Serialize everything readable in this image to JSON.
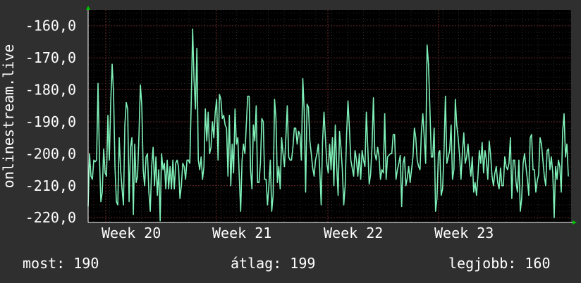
{
  "chart_data": {
    "type": "line",
    "ylabel": "onlinestream.live",
    "ylim": [
      -220,
      -155
    ],
    "yticks": [
      -160,
      -170,
      -180,
      -190,
      -200,
      -210,
      -220
    ],
    "ytick_labels": [
      "-160,0",
      "-170,0",
      "-180,0",
      "-190,0",
      "-200,0",
      "-210,0",
      "-220,0"
    ],
    "week_labels": [
      "Week 20",
      "Week 21",
      "Week 22",
      "Week 23"
    ],
    "grid": true,
    "series_color": "#7ff0b8",
    "x": [
      0,
      2,
      4,
      6,
      8,
      10,
      12,
      14,
      16,
      18,
      20,
      22,
      24,
      26,
      28,
      30,
      32,
      34,
      36,
      38,
      40,
      42,
      44,
      46,
      48,
      50,
      52,
      54,
      56,
      58,
      60,
      62,
      64,
      66,
      68,
      70,
      72,
      74,
      76,
      78,
      80,
      82,
      84,
      86,
      88,
      90,
      92,
      94,
      96,
      98,
      100,
      102,
      104,
      106,
      108,
      110,
      112,
      114,
      116,
      118,
      120,
      122,
      124,
      126,
      128,
      130,
      132,
      134,
      136,
      138,
      140,
      142,
      144,
      146,
      148,
      150,
      152,
      154,
      156,
      158,
      160,
      162,
      164,
      166,
      168,
      170,
      172,
      174,
      176,
      178,
      180,
      182,
      184,
      186,
      188,
      190,
      192,
      194,
      196,
      198,
      200,
      202,
      204,
      206,
      208,
      210,
      212,
      214,
      216,
      218,
      220,
      222,
      224,
      226,
      228,
      230,
      232,
      234,
      236,
      238,
      240,
      242,
      244,
      246,
      248,
      250,
      252,
      254,
      256,
      258,
      260,
      262,
      264,
      266,
      268,
      270,
      272,
      274,
      276,
      278,
      280,
      282,
      284,
      286,
      288,
      290,
      292,
      294,
      296,
      298,
      300,
      302,
      304,
      306,
      308,
      310,
      312,
      314,
      316,
      318,
      320,
      322,
      324,
      326,
      328,
      330,
      332,
      334,
      336,
      338,
      340,
      342,
      344,
      346,
      348,
      350,
      352,
      354,
      356,
      358,
      360,
      362,
      364,
      366,
      368,
      370,
      372,
      374,
      376,
      378,
      380,
      382,
      384,
      386,
      388,
      390,
      392,
      394,
      396,
      398,
      400,
      402,
      404,
      406,
      408,
      410,
      412,
      414,
      416,
      418,
      420,
      422,
      424,
      426,
      428,
      430,
      432,
      434,
      436,
      438,
      440,
      442,
      444,
      446,
      448,
      450,
      452,
      454,
      456,
      458,
      460,
      462,
      464,
      466,
      468,
      470,
      472,
      474,
      476,
      478,
      480,
      482,
      484,
      486,
      488,
      490,
      492,
      494,
      496,
      498,
      500,
      502,
      504,
      506,
      508,
      510,
      512,
      514,
      516,
      518,
      520,
      522,
      524,
      526,
      528,
      530,
      532,
      534,
      536,
      538,
      540,
      542,
      544,
      546,
      548,
      550,
      552,
      554,
      556,
      558,
      560,
      562,
      564,
      566,
      568,
      570,
      572,
      574,
      576,
      578,
      580,
      582,
      584,
      586,
      588,
      590,
      592,
      594,
      596,
      598,
      600,
      602,
      604,
      606,
      608,
      610,
      612,
      614,
      616,
      618,
      620,
      622,
      624,
      626,
      628,
      630,
      632,
      634,
      636,
      638,
      640,
      642,
      644,
      646,
      648,
      650,
      652,
      654,
      656,
      658,
      660,
      662,
      664,
      666,
      668,
      670,
      672,
      674,
      676,
      678,
      680
    ],
    "y": [
      -216.5,
      -200.0,
      -207.0,
      -208.0,
      -202.0,
      -202.5,
      -202.0,
      -178.0,
      -201.0,
      -215.0,
      -212.0,
      -198.5,
      -206.0,
      -207.0,
      -188.0,
      -202.0,
      -184.0,
      -172.0,
      -181.0,
      -204.0,
      -215.0,
      -216.0,
      -195.0,
      -205.0,
      -211.0,
      -216.0,
      -191.0,
      -184.0,
      -186.0,
      -215.0,
      -198.0,
      -195.0,
      -219.0,
      -197.0,
      -209.0,
      -207.0,
      -194.0,
      -178.5,
      -185.0,
      -205.0,
      -210.0,
      -201.0,
      -200.0,
      -212.0,
      -218.0,
      -204.0,
      -198.0,
      -210.0,
      -201.0,
      -213.0,
      -205.0,
      -221.0,
      -200.0,
      -205.0,
      -203.0,
      -211.0,
      -202.0,
      -211.0,
      -204.0,
      -211.0,
      -202.0,
      -211.0,
      -203.0,
      -202.0,
      -204.0,
      -214.0,
      -210.0,
      -203.0,
      -204.0,
      -208.0,
      -202.0,
      -202.0,
      -203.0,
      -184.0,
      -161.0,
      -177.0,
      -186.0,
      -167.0,
      -202.0,
      -205.0,
      -201.0,
      -208.0,
      -204.0,
      -186.0,
      -196.0,
      -187.0,
      -200.0,
      -198.0,
      -190.0,
      -195.0,
      -187.0,
      -183.0,
      -202.0,
      -181.5,
      -183.0,
      -189.0,
      -188.0,
      -191.0,
      -192.0,
      -207.0,
      -188.0,
      -210.0,
      -197.0,
      -206.0,
      -186.0,
      -197.0,
      -195.0,
      -207.0,
      -218.0,
      -202.0,
      -197.0,
      -200.0,
      -191.0,
      -182.0,
      -182.0,
      -205.0,
      -211.0,
      -191.0,
      -196.0,
      -185.0,
      -209.0,
      -209.0,
      -203.0,
      -189.0,
      -190.0,
      -208.0,
      -208.0,
      -216.0,
      -210.0,
      -202.0,
      -218.0,
      -213.0,
      -183.0,
      -189.0,
      -209.0,
      -204.0,
      -211.0,
      -195.0,
      -200.0,
      -204.0,
      -195.0,
      -185.0,
      -201.0,
      -202.0,
      -202.0,
      -198.0,
      -192.0,
      -192.0,
      -197.0,
      -193.0,
      -194.0,
      -202.0,
      -176.5,
      -186.5,
      -212.0,
      -184.5,
      -185.5,
      -196.0,
      -200.0,
      -204.5,
      -207.0,
      -202.0,
      -200.0,
      -197.0,
      -205.0,
      -216.0,
      -196.0,
      -187.0,
      -195.0,
      -203.0,
      -206.0,
      -197.0,
      -205.0,
      -195.0,
      -210.0,
      -191.0,
      -204.0,
      -213.0,
      -193.0,
      -198.0,
      -205.0,
      -216.0,
      -210.0,
      -194.0,
      -183.5,
      -192.0,
      -202.0,
      -204.5,
      -207.0,
      -199.0,
      -202.0,
      -207.0,
      -200.0,
      -208.0,
      -199.0,
      -202.0,
      -204.0,
      -187.0,
      -198.0,
      -209.5,
      -206.5,
      -198.0,
      -182.5,
      -200.0,
      -202.0,
      -198.0,
      -201.0,
      -208.0,
      -205.0,
      -206.0,
      -187.5,
      -208.0,
      -201.0,
      -200.5,
      -200.0,
      -200.0,
      -194.0,
      -194.0,
      -208.0,
      -205.0,
      -203.0,
      -200.5,
      -216.5,
      -203.0,
      -201.0,
      -210.0,
      -207.5,
      -204.0,
      -209.0,
      -205.0,
      -201.0,
      -192.0,
      -195.0,
      -202.0,
      -204.0,
      -205.0,
      -193.0,
      -187.5,
      -195.0,
      -203.0,
      -166.0,
      -172.0,
      -186.0,
      -201.0,
      -201.0,
      -192.0,
      -218.0,
      -214.0,
      -200.0,
      -199.0,
      -213.0,
      -211.0,
      -199.0,
      -182.0,
      -203.0,
      -201.0,
      -199.0,
      -191.0,
      -208.0,
      -205.0,
      -183.0,
      -191.0,
      -195.0,
      -200.5,
      -208.0,
      -199.5,
      -193.5,
      -203.0,
      -201.0,
      -197.0,
      -203.0,
      -207.0,
      -201.0,
      -212.0,
      -209.0,
      -213.0,
      -207.0,
      -199.0,
      -203.0,
      -196.5,
      -206.0,
      -199.0,
      -202.0,
      -208.0,
      -196.0,
      -200.5,
      -207.0,
      -210.0,
      -206.0,
      -204.0,
      -209.0,
      -211.0,
      -204.5,
      -210.0,
      -210.0,
      -201.0,
      -204.0,
      -205.0,
      -203.0,
      -195.0,
      -214.0,
      -202.0,
      -202.0,
      -209.0,
      -212.0,
      -202.0,
      -218.0,
      -214.0,
      -203.0,
      -200.0,
      -204.0,
      -208.0,
      -213.0,
      -195.0,
      -194.0,
      -205.0,
      -205.0,
      -212.0,
      -208.5,
      -206.5,
      -195.0,
      -197.0,
      -202.0,
      -207.0,
      -210.0,
      -199.0,
      -198.5,
      -205.0,
      -201.0,
      -206.0,
      -220.0,
      -204.0,
      -208.0,
      -202.0,
      -204.0,
      -212.0,
      -193.0,
      -187.5,
      -201.0,
      -197.0,
      -207.0
    ]
  },
  "footer": {
    "current": "most: 190",
    "average": "átlag: 199",
    "best": "legjobb: 160"
  }
}
